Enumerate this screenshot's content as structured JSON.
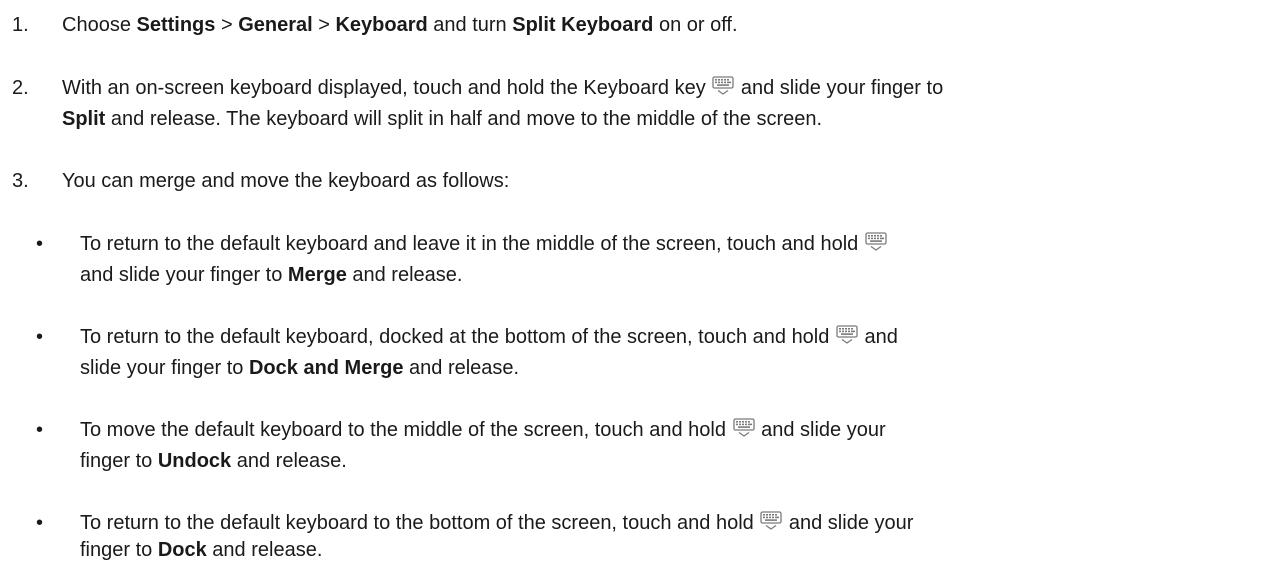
{
  "steps": [
    {
      "number": "1.",
      "parts": [
        "Choose ",
        "Settings",
        " > ",
        "General",
        " > ",
        "Keyboard",
        " and turn ",
        "Split Keyboard",
        " on or off."
      ]
    },
    {
      "number": "2.",
      "parts": [
        "With an on-screen keyboard displayed, touch and hold the Keyboard key ",
        " and slide your finger to",
        "Split",
        " and release. The keyboard will split in half and move to the middle of the screen."
      ]
    },
    {
      "number": "3.",
      "text": "You can merge and move the keyboard as follows:"
    }
  ],
  "bullets": [
    {
      "symbol": "•",
      "line1": "To return to the default keyboard and leave it in the middle of the screen, touch and hold",
      "line2_a": "and slide your finger to ",
      "bold": "Merge",
      "line2_b": " and release."
    },
    {
      "symbol": "•",
      "line1_a": "To return to the default keyboard, docked at the bottom of the screen, touch and hold ",
      "line1_b": " and",
      "line2_a": "slide your finger to ",
      "bold": "Dock and Merge",
      "line2_b": " and release."
    },
    {
      "symbol": "•",
      "line1_a": "To move the default keyboard to the middle of the screen, touch and hold ",
      "line1_b": " and slide your",
      "line2_a": "finger to ",
      "bold": "Undock",
      "line2_b": " and release."
    },
    {
      "symbol": "•",
      "line1_a": "To return to the default keyboard to the bottom of the screen, touch and hold ",
      "line1_b": " and slide your",
      "line2_a": "finger to ",
      "bold": "Dock",
      "line2_b": " and release."
    }
  ],
  "icons": {
    "keyboard_key": "keyboard-hide-icon",
    "icon_color": "#7a7a7a"
  }
}
